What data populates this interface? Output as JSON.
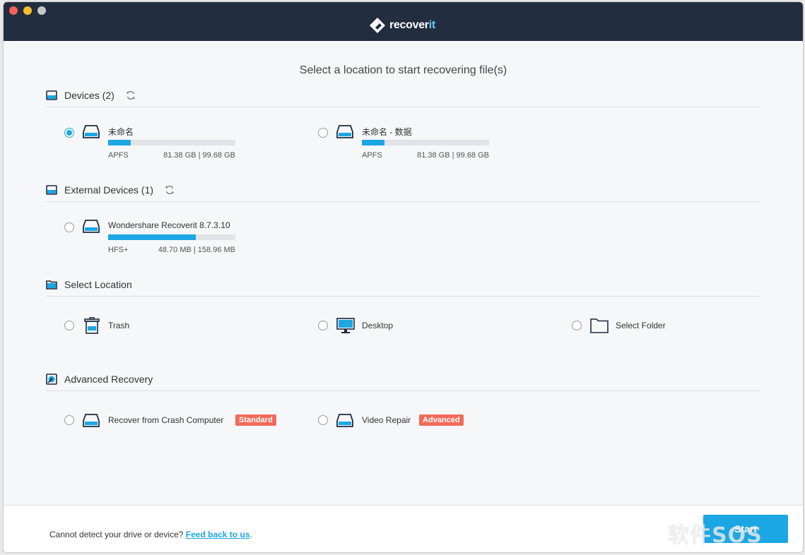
{
  "app": {
    "logo_main": "recover",
    "logo_accent": "it"
  },
  "heading": "Select a location to start recovering file(s)",
  "sections": {
    "devices": {
      "label": "Devices (2)",
      "items": [
        {
          "name": "未命名",
          "fs": "APFS",
          "size": "81.38 GB | 99.68 GB",
          "selected": true,
          "usage": 0.18
        },
        {
          "name": "未命名 - 数据",
          "fs": "APFS",
          "size": "81.38 GB | 99.68 GB",
          "selected": false,
          "usage": 0.18
        }
      ]
    },
    "external": {
      "label": "External Devices (1)",
      "items": [
        {
          "name": "Wondershare Recoverit 8.7.3.10",
          "fs": "HFS+",
          "size": "48.70 MB | 158.96 MB",
          "selected": false,
          "usage": 0.69
        }
      ]
    },
    "location": {
      "label": "Select Location",
      "items": [
        {
          "label": "Trash",
          "icon": "trash-icon"
        },
        {
          "label": "Desktop",
          "icon": "monitor-icon"
        },
        {
          "label": "Select Folder",
          "icon": "folder-icon"
        }
      ]
    },
    "advanced": {
      "label": "Advanced Recovery",
      "items": [
        {
          "label": "Recover from Crash Computer",
          "badge": "Standard"
        },
        {
          "label": "Video Repair",
          "badge": "Advanced"
        }
      ]
    }
  },
  "footer": {
    "text": "Cannot detect your drive or device? ",
    "link": "Feed back to us",
    "suffix": ".",
    "start_label": "Start"
  },
  "watermark": "软件SOS",
  "colors": {
    "titlebar": "#232d40",
    "accent": "#1ba7e3",
    "badge": "#f26a5a"
  }
}
